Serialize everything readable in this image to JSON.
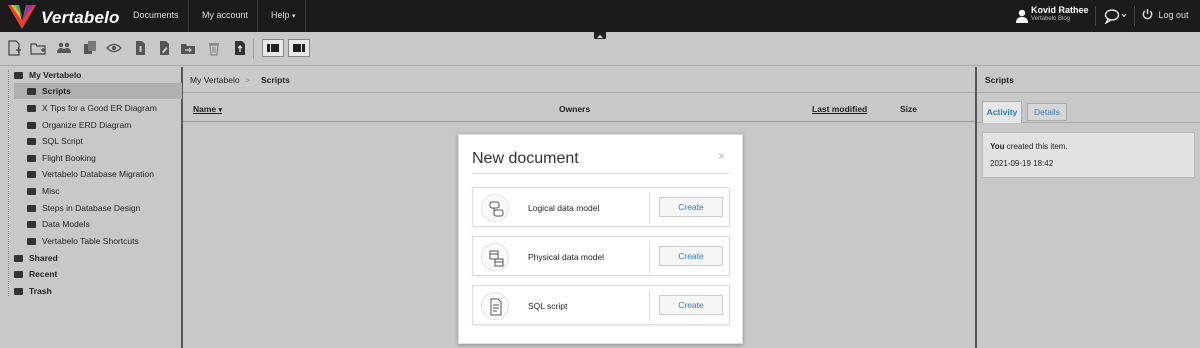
{
  "app": {
    "name": "Vertabelo"
  },
  "topnav": {
    "items": [
      "Documents",
      "My account",
      "Help"
    ]
  },
  "user": {
    "name": "Kovid Rathee",
    "org": "Vertabelo Blog",
    "logout": "Log out"
  },
  "sidebar": {
    "root": "My Vertabelo",
    "selected": "Scripts",
    "items": [
      "Scripts",
      "X Tips for a Good ER Diagram",
      "Organize ERD Diagram",
      "SQL Script",
      "Flight Booking",
      "Vertabelo Database Migration",
      "Misc",
      "Steps in Database Design",
      "Data Models",
      "Vertabelo Table Shortcuts"
    ],
    "sections": [
      "Shared",
      "Recent",
      "Trash"
    ]
  },
  "breadcrumb": {
    "root": "My Vertabelo",
    "separator": ">",
    "current": "Scripts"
  },
  "columns": {
    "name": "Name",
    "owners": "Owners",
    "last_modified": "Last modified",
    "size": "Size"
  },
  "right": {
    "title": "Scripts",
    "tabs": [
      "Activity",
      "Details"
    ],
    "activity_user": "You",
    "activity_text": "created this item.",
    "activity_time": "2021-09-19 18:42"
  },
  "modal": {
    "title": "New document",
    "close": "×",
    "options": [
      {
        "label": "Logical data model",
        "button": "Create"
      },
      {
        "label": "Physical data model",
        "button": "Create"
      },
      {
        "label": "SQL script",
        "button": "Create"
      }
    ]
  },
  "colors": {
    "accent": "#2a7fc0",
    "topbar": "#1b1b1b"
  }
}
